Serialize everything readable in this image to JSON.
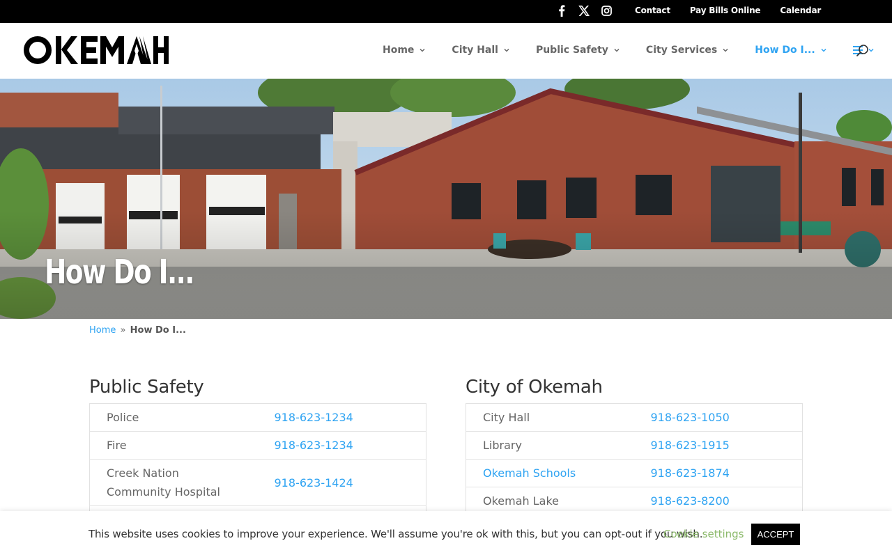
{
  "topbar": {
    "social": [
      "facebook-icon",
      "x-icon",
      "instagram-icon"
    ],
    "links": [
      "Contact",
      "Pay Bills Online",
      "Calendar"
    ]
  },
  "header": {
    "logo_text": "OKEMAH",
    "nav": [
      {
        "label": "Home",
        "active": false
      },
      {
        "label": "City Hall",
        "active": false
      },
      {
        "label": "Public Safety",
        "active": false
      },
      {
        "label": "City Services",
        "active": false
      },
      {
        "label": "How Do I...",
        "active": true
      }
    ],
    "menu_icon": "hamburger-icon",
    "search_icon": "search-icon"
  },
  "hero": {
    "title": "How Do I..."
  },
  "breadcrumb": {
    "home": "Home",
    "separator": "»",
    "current": "How Do I..."
  },
  "public_safety": {
    "heading": "Public Safety",
    "rows": [
      {
        "name": "Police",
        "phone": "918-623-1234"
      },
      {
        "name": "Fire",
        "phone": "918-623-1234"
      },
      {
        "name": "Creek Nation Community Hospital",
        "phone": "918-623-1424"
      }
    ]
  },
  "city": {
    "heading": "City of Okemah",
    "rows": [
      {
        "name": "City Hall",
        "phone": "918-623-1050"
      },
      {
        "name": "Library",
        "phone": "918-623-1915"
      },
      {
        "name": "Okemah Schools",
        "phone": "918-623-1874"
      },
      {
        "name": "Okemah Lake",
        "phone": "918-623-8200"
      }
    ]
  },
  "cookie": {
    "message": "This website uses cookies to improve your experience. We'll assume you're ok with this, but you can opt-out if you wish.",
    "settings": "Cookie settings",
    "accept": "ACCEPT"
  },
  "colors": {
    "accent": "#2ea3f2",
    "cookie_settings": "#8bb96a",
    "topbar": "#000000"
  }
}
